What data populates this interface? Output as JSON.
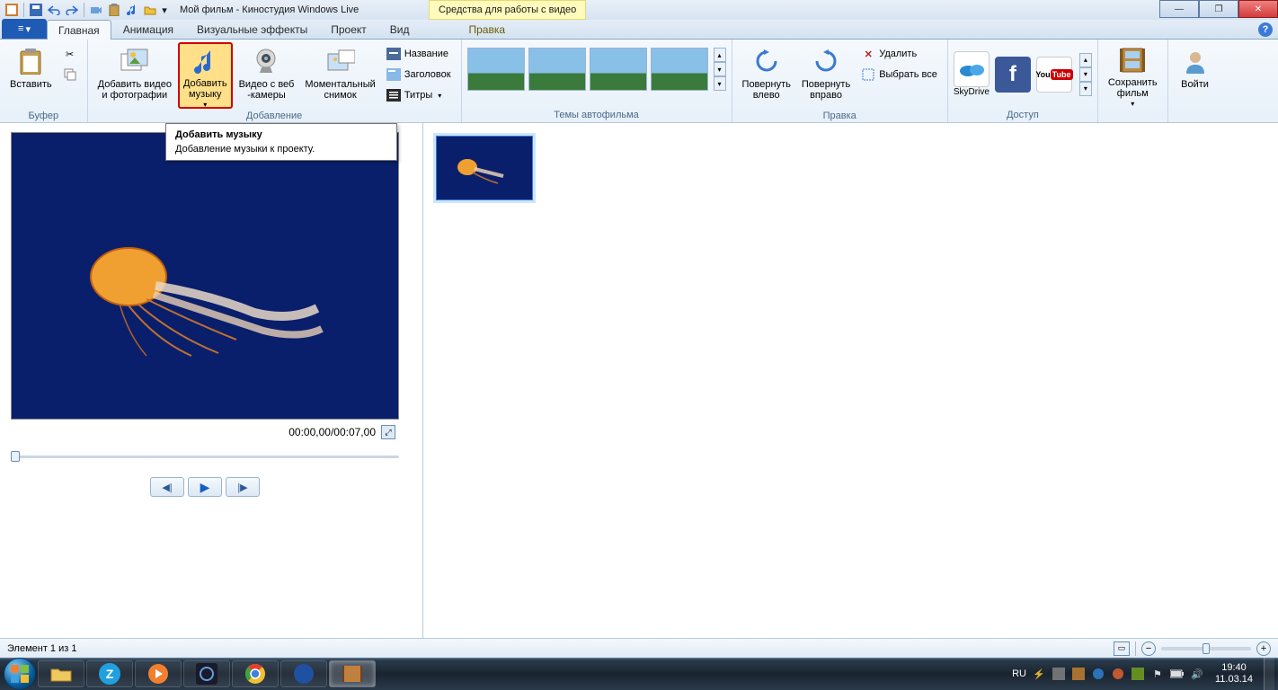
{
  "title": "Мой фильм - Киностудия Windows Live",
  "context_tab": "Средства для работы с видео",
  "qat_icons": [
    "app",
    "save",
    "undo",
    "redo",
    "camera",
    "paste",
    "music",
    "folder",
    "dropdown"
  ],
  "tabs": {
    "file_icon": "≡",
    "items": [
      "Главная",
      "Анимация",
      "Визуальные эффекты",
      "Проект",
      "Вид"
    ],
    "context_item": "Правка"
  },
  "ribbon": {
    "buffer": {
      "label": "Буфер",
      "paste": "Вставить"
    },
    "add": {
      "label": "Добавление",
      "add_videos_photos": "Добавить видео\nи фотографии",
      "add_music": "Добавить\nмузыку",
      "webcam": "Видео с веб\n-камеры",
      "snapshot": "Моментальный\nснимок",
      "title": "Название",
      "heading": "Заголовок",
      "credits": "Титры"
    },
    "themes_label": "Темы автофильма",
    "edit": {
      "label": "Правка",
      "rotate_left": "Повернуть\nвлево",
      "rotate_right": "Повернуть\nвправо",
      "delete": "Удалить",
      "select_all": "Выбрать все"
    },
    "share": {
      "label": "Доступ",
      "skydrive": "SkyDrive"
    },
    "save_movie": "Сохранить\nфильм",
    "signin": "Войти"
  },
  "tooltip": {
    "title": "Добавить музыку",
    "body": "Добавление музыки к проекту."
  },
  "preview": {
    "time": "00:00,00/00:07,00"
  },
  "status": {
    "left": "Элемент 1 из 1"
  },
  "taskbar": {
    "lang": "RU",
    "time": "19:40",
    "date": "11.03.14"
  }
}
